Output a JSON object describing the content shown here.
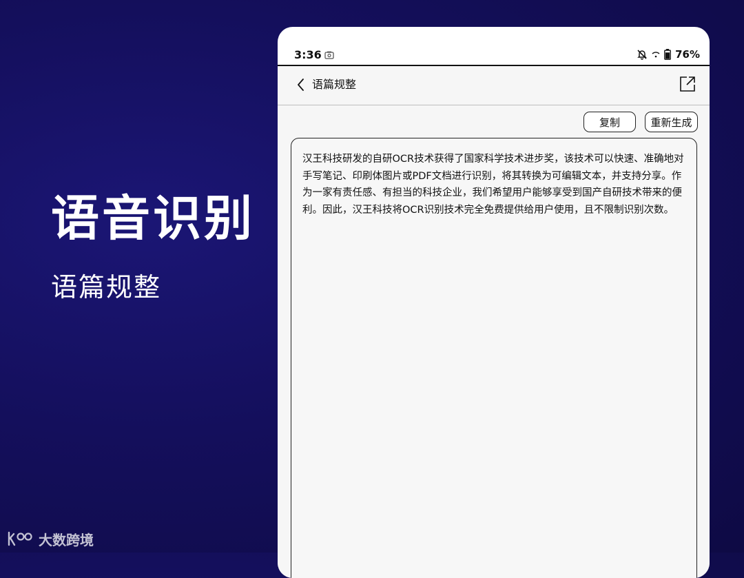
{
  "promo": {
    "headline": "语音识别",
    "subheadline": "语篇规整"
  },
  "watermark": {
    "text": "大数跨境"
  },
  "device": {
    "status_bar": {
      "time": "3:36",
      "battery": "76%",
      "icons": [
        "screenshot-icon",
        "bell-off-icon",
        "wifi-icon",
        "battery-icon"
      ]
    },
    "nav": {
      "title": "语篇规整",
      "back_icon": "chevron-left-icon",
      "share_icon": "share-icon"
    },
    "actions": {
      "copy_label": "复制",
      "regenerate_label": "重新生成"
    },
    "result_text": "汉王科技研发的自研OCR技术获得了国家科学技术进步奖，该技术可以快速、准确地对手写笔记、印刷体图片或PDF文档进行识别，将其转换为可编辑文本，并支持分享。作为一家有责任感、有担当的科技企业，我们希望用户能够享受到国产自研技术带来的便利。因此，汉王科技将OCR识别技术完全免费提供给用户使用，且不限制识别次数。"
  },
  "colors": {
    "background": "#140f5c",
    "device_bg": "#ffffff",
    "screen_bg": "#f6f6f6"
  }
}
